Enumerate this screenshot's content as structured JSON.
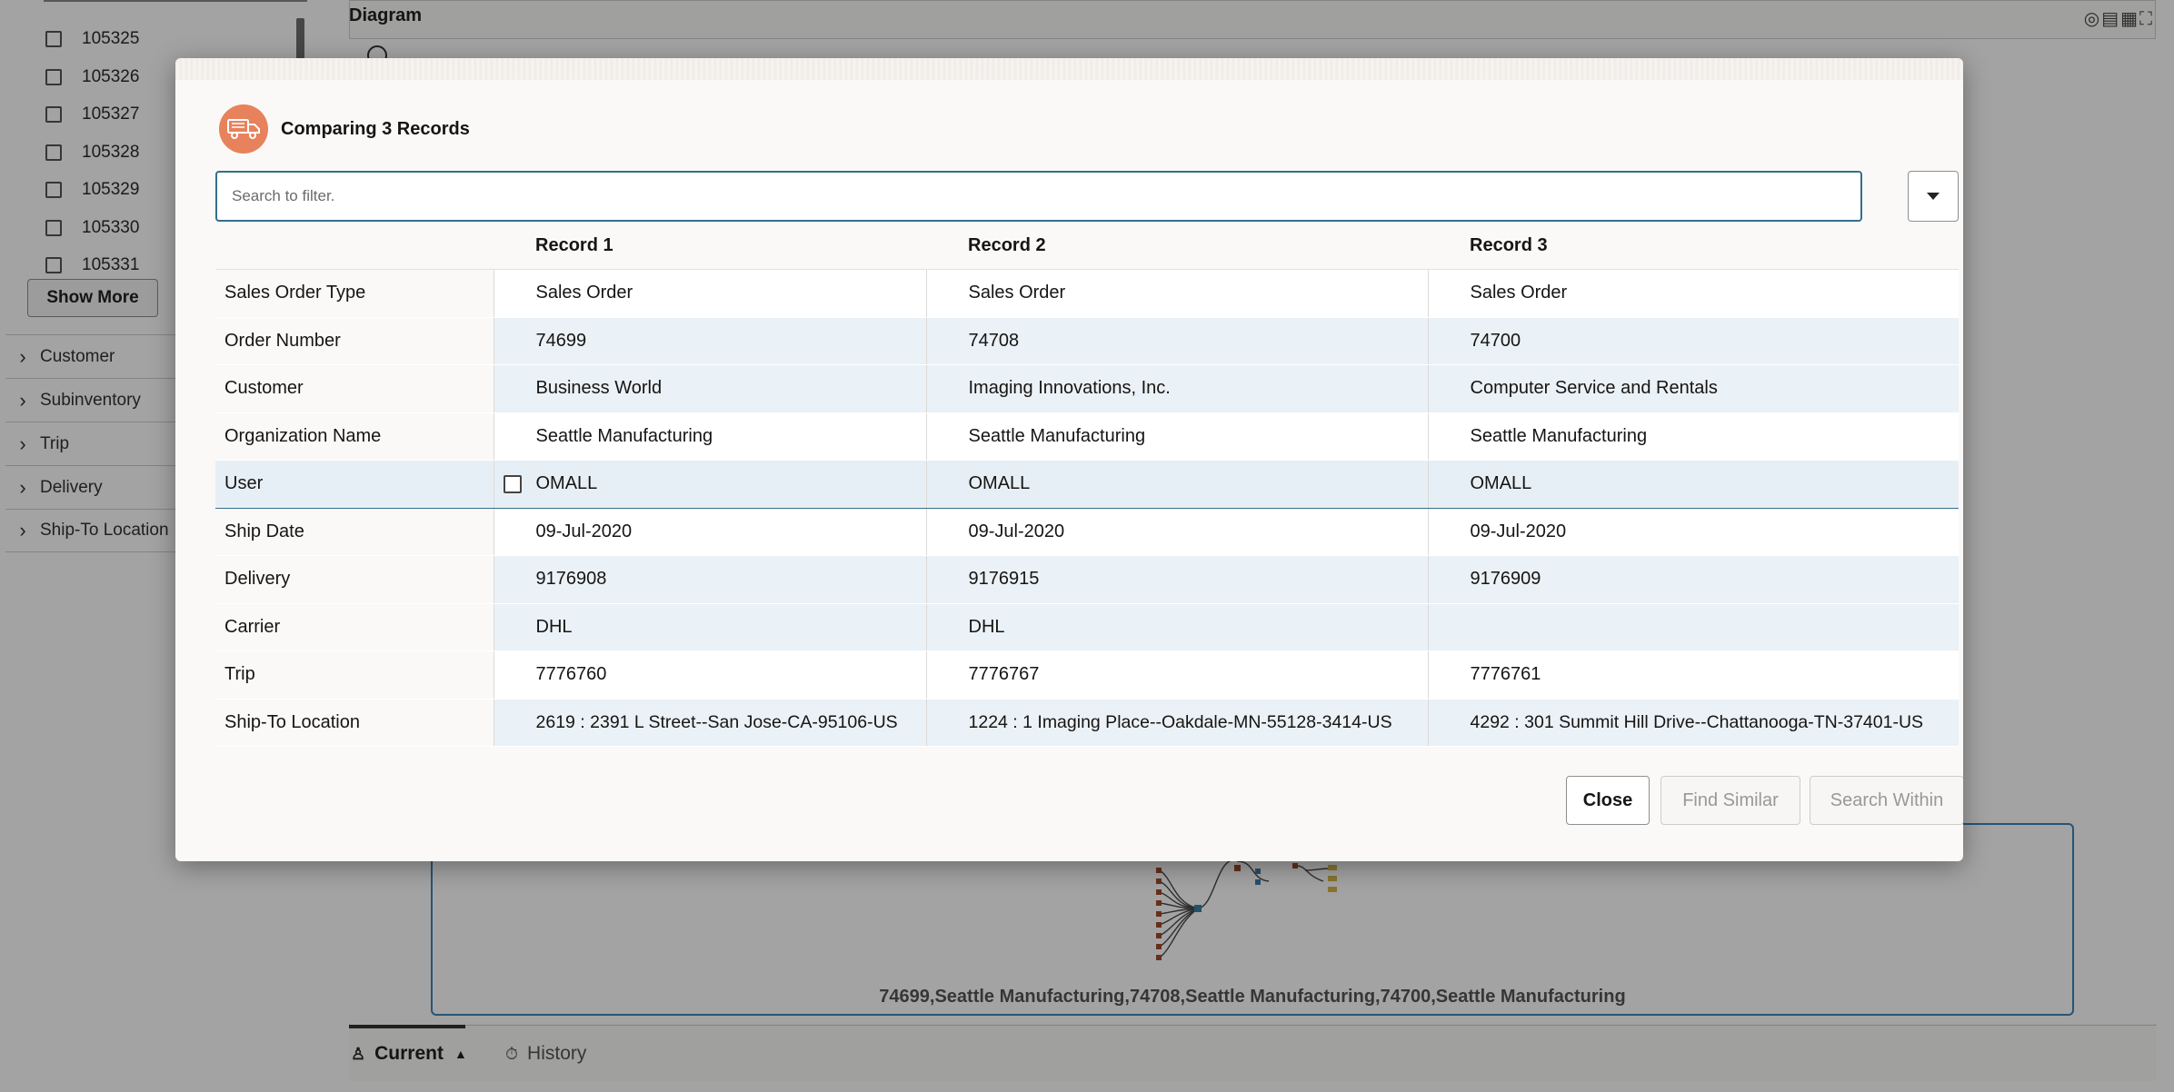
{
  "left_panel": {
    "ids": [
      "105325",
      "105326",
      "105327",
      "105328",
      "105329",
      "105330",
      "105331"
    ],
    "show_more_label": "Show More",
    "facets": [
      "Customer",
      "Subinventory",
      "Trip",
      "Delivery",
      "Ship-To Location"
    ]
  },
  "diagram": {
    "title": "Diagram",
    "mini_caption": "74699,Seattle Manufacturing,74708,Seattle Manufacturing,74700,Seattle Manufacturing",
    "tabs": [
      {
        "label": "Current",
        "icon": "person-icon"
      },
      {
        "label": "History",
        "icon": "timer-icon"
      }
    ]
  },
  "dialog": {
    "title": "Comparing 3 Records",
    "icon": "truck-icon",
    "icon_color": "#e8825c",
    "search_placeholder": "Search to filter.",
    "columns": [
      "Record 1",
      "Record 2",
      "Record 3"
    ],
    "rows": [
      {
        "label": "Sales Order Type",
        "values": [
          "Sales Order",
          "Sales Order",
          "Sales Order"
        ]
      },
      {
        "label": "Order Number",
        "values": [
          "74699",
          "74708",
          "74700"
        ]
      },
      {
        "label": "Customer",
        "values": [
          "Business World",
          "Imaging Innovations, Inc.",
          "Computer Service and Rentals"
        ]
      },
      {
        "label": "Organization Name",
        "values": [
          "Seattle Manufacturing",
          "Seattle Manufacturing",
          "Seattle Manufacturing"
        ]
      },
      {
        "label": "User",
        "values": [
          "OMALL",
          "OMALL",
          "OMALL"
        ]
      },
      {
        "label": "Ship Date",
        "values": [
          "09-Jul-2020",
          "09-Jul-2020",
          "09-Jul-2020"
        ]
      },
      {
        "label": "Delivery",
        "values": [
          "9176908",
          "9176915",
          "9176909"
        ]
      },
      {
        "label": "Carrier",
        "values": [
          "DHL",
          "DHL",
          ""
        ]
      },
      {
        "label": "Trip",
        "values": [
          "7776760",
          "7776767",
          "7776761"
        ]
      },
      {
        "label": "Ship-To Location",
        "values": [
          "2619 : 2391 L Street--San Jose-CA-95106-US",
          "1224 : 1 Imaging Place--Oakdale-MN-55128-3414-US",
          "4292 : 301 Summit Hill Drive--Chattanooga-TN-37401-US"
        ]
      }
    ],
    "buttons": {
      "close": "Close",
      "find_similar": "Find Similar",
      "search_within": "Search Within"
    }
  }
}
